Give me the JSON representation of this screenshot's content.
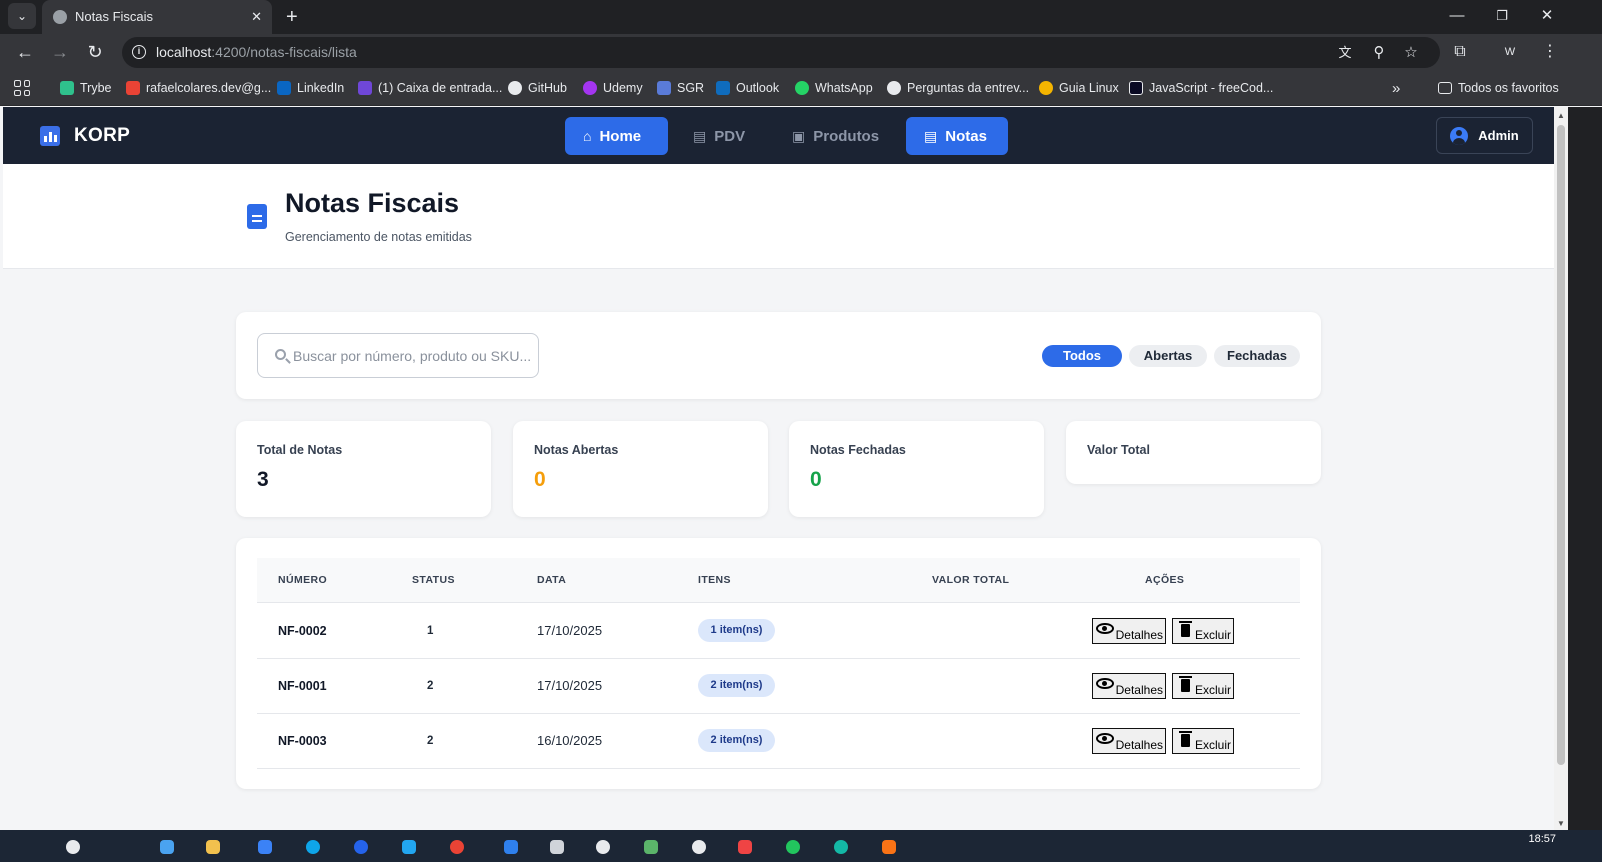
{
  "browser": {
    "tab_title": "Notas Fiscais",
    "url_host": "localhost",
    "url_path": ":4200/notas-fiscais/lista",
    "profile_initial": "W",
    "bookmarks": [
      {
        "label": "Trybe",
        "color": "#2fc18c"
      },
      {
        "label": "rafaelcolares.dev@g...",
        "color": "#ea4335"
      },
      {
        "label": "LinkedIn",
        "color": "#0a66c2"
      },
      {
        "label": "(1) Caixa de entrada...",
        "color": "#6f47d8"
      },
      {
        "label": "GitHub",
        "color": "#e8eaed"
      },
      {
        "label": "Udemy",
        "color": "#a435f0"
      },
      {
        "label": "SGR",
        "color": "#5a7bd8"
      },
      {
        "label": "Outlook",
        "color": "#0f6cbd"
      },
      {
        "label": "WhatsApp",
        "color": "#25d366"
      },
      {
        "label": "Perguntas da entrev...",
        "color": "#e8eaed"
      },
      {
        "label": "Guia Linux",
        "color": "#f4b400"
      },
      {
        "label": "JavaScript - freeCod...",
        "color": "#0a0a23"
      }
    ],
    "all_bookmarks": "Todos os favoritos",
    "clock": "18:57"
  },
  "header": {
    "brand": "KORP",
    "nav": [
      {
        "label": "Home",
        "icon": "home-icon",
        "active": true
      },
      {
        "label": "PDV",
        "icon": "cash-register-icon",
        "active": false
      },
      {
        "label": "Produtos",
        "icon": "box-icon",
        "active": false
      },
      {
        "label": "Notas",
        "icon": "document-icon",
        "active": true
      }
    ],
    "user": "Admin"
  },
  "page": {
    "title": "Notas Fiscais",
    "subtitle": "Gerenciamento de notas emitidas"
  },
  "filters": {
    "search_placeholder": "Buscar por número, produto ou SKU...",
    "options": [
      "Todos",
      "Abertas",
      "Fechadas"
    ],
    "selected": "Todos"
  },
  "stats": [
    {
      "label": "Total de Notas",
      "value": "3",
      "color": "#111827"
    },
    {
      "label": "Notas Abertas",
      "value": "0",
      "color": "#f59e0b"
    },
    {
      "label": "Notas Fechadas",
      "value": "0",
      "color": "#16a34a"
    },
    {
      "label": "Valor Total",
      "value": "",
      "color": "#111827"
    }
  ],
  "table": {
    "columns": [
      "NÚMERO",
      "STATUS",
      "DATA",
      "ITENS",
      "VALOR TOTAL",
      "AÇÕES"
    ],
    "rows": [
      {
        "numero": "NF-0002",
        "status": "1",
        "data": "17/10/2025",
        "itens": "1 item(ns)",
        "valor": ""
      },
      {
        "numero": "NF-0001",
        "status": "2",
        "data": "17/10/2025",
        "itens": "2 item(ns)",
        "valor": ""
      },
      {
        "numero": "NF-0003",
        "status": "2",
        "data": "16/10/2025",
        "itens": "2 item(ns)",
        "valor": ""
      }
    ],
    "action_details": "Detalhes",
    "action_delete": "Excluir"
  }
}
